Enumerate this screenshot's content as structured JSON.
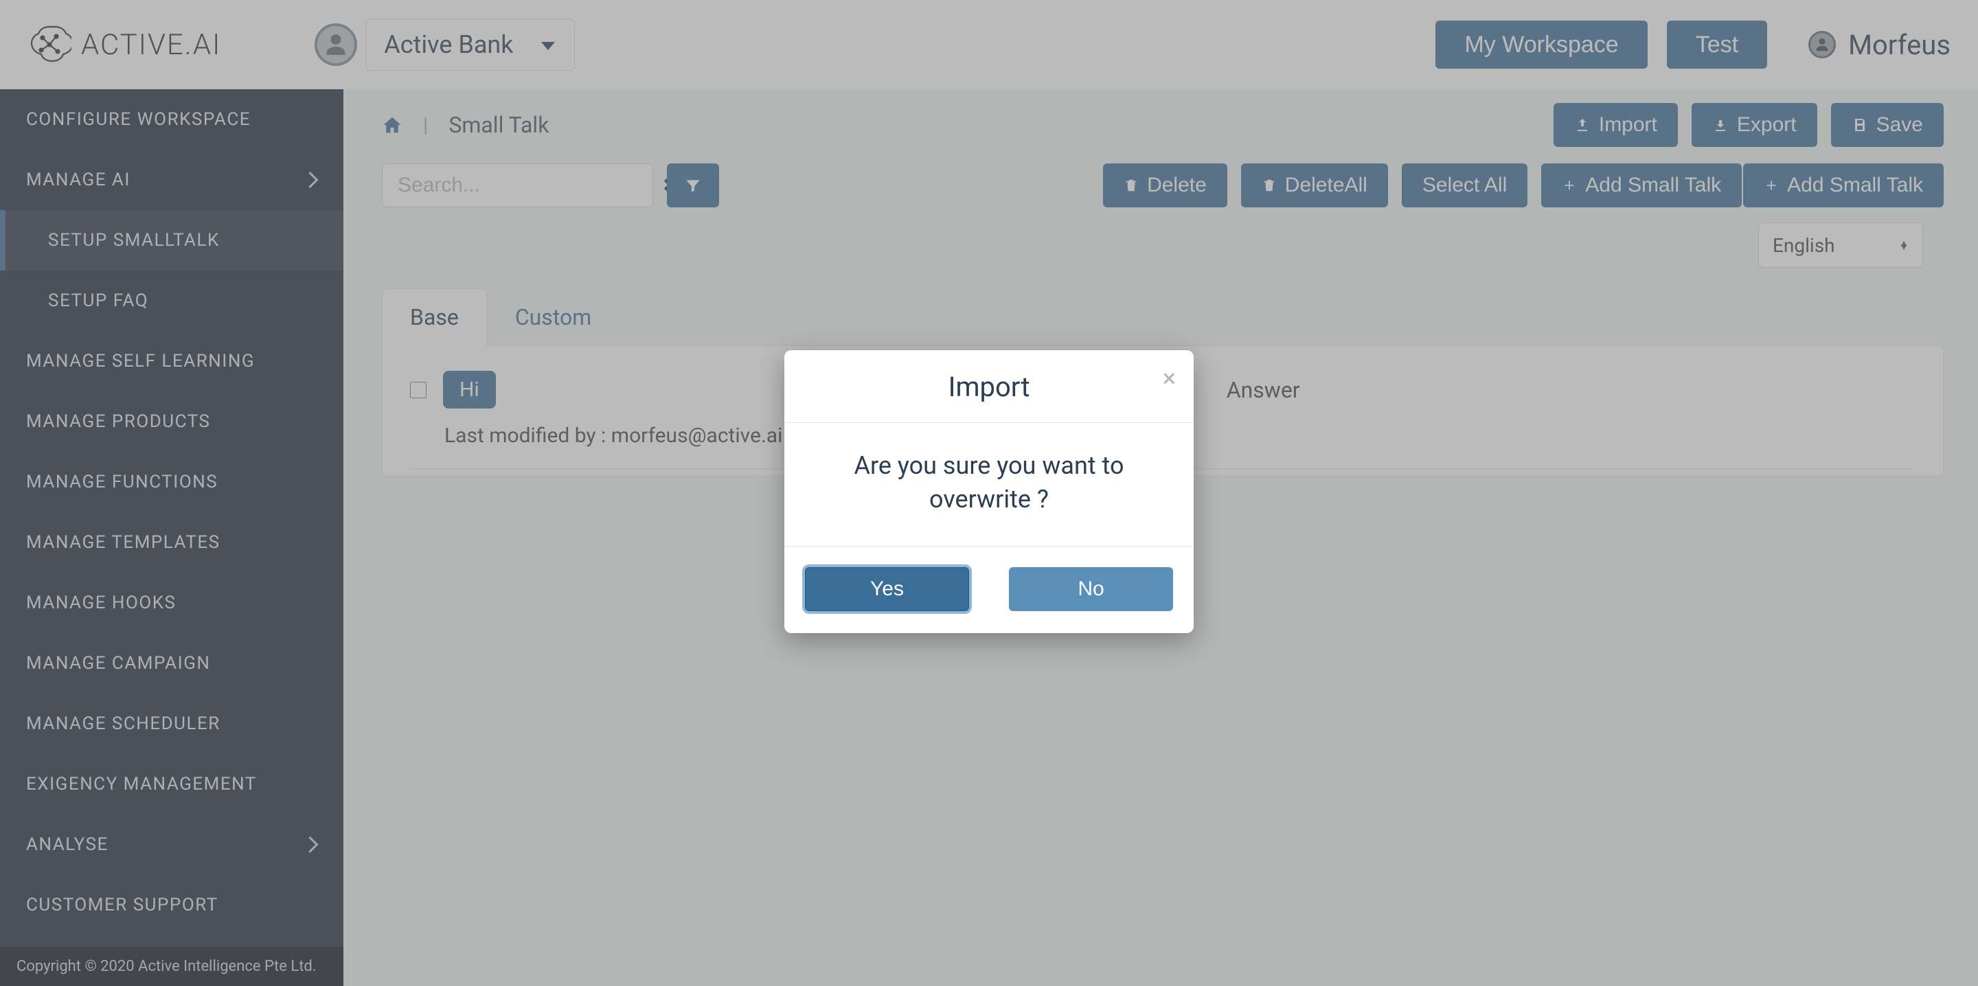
{
  "header": {
    "brand": "ACTIVE.AI",
    "project": "Active Bank",
    "my_workspace": "My Workspace",
    "test": "Test",
    "user": "Morfeus"
  },
  "sidebar": {
    "items": [
      {
        "label": "CONFIGURE WORKSPACE"
      },
      {
        "label": "MANAGE AI",
        "expandable": true
      },
      {
        "label": "SETUP SMALLTALK",
        "sub": true,
        "active": true
      },
      {
        "label": "SETUP FAQ",
        "sub": true
      },
      {
        "label": "MANAGE SELF LEARNING"
      },
      {
        "label": "MANAGE PRODUCTS"
      },
      {
        "label": "MANAGE FUNCTIONS"
      },
      {
        "label": "MANAGE TEMPLATES"
      },
      {
        "label": "MANAGE HOOKS"
      },
      {
        "label": "MANAGE CAMPAIGN"
      },
      {
        "label": "MANAGE SCHEDULER"
      },
      {
        "label": "EXIGENCY MANAGEMENT"
      },
      {
        "label": "ANALYSE",
        "expandable": true
      },
      {
        "label": "CUSTOMER SUPPORT"
      }
    ],
    "footer": "Copyright © 2020 Active Intelligence Pte Ltd."
  },
  "breadcrumb": {
    "page": "Small Talk"
  },
  "actions_primary": {
    "import": "Import",
    "export": "Export",
    "save": "Save"
  },
  "search": {
    "placeholder": "Search..."
  },
  "actions_secondary": {
    "delete": "Delete",
    "delete_all": "DeleteAll",
    "select_all": "Select All",
    "add1": "Add Small Talk",
    "add2": "Add Small Talk"
  },
  "language": {
    "selected": "English"
  },
  "tabs": {
    "base": "Base",
    "custom": "Custom"
  },
  "row": {
    "chip": "Hi",
    "answer_label": "Answer",
    "modified": "Last modified by : morfeus@active.ai on"
  },
  "modal": {
    "title": "Import",
    "message": "Are you sure you want to overwrite ?",
    "yes": "Yes",
    "no": "No"
  }
}
